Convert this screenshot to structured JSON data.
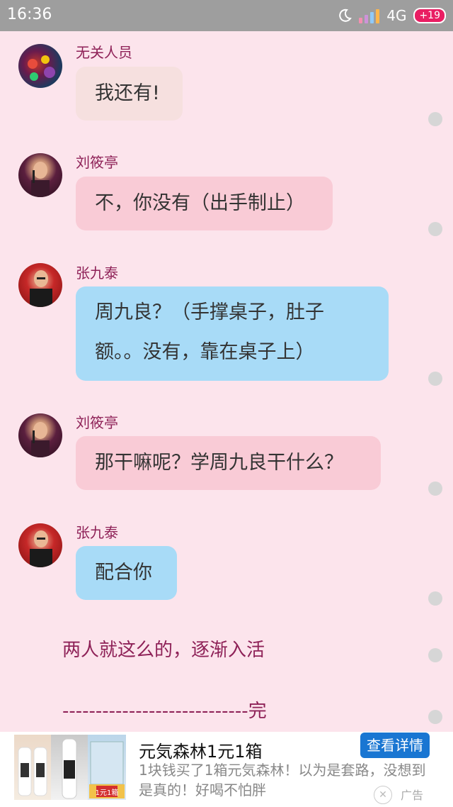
{
  "status_bar": {
    "time": "16:36",
    "network": "4G",
    "battery": "+19",
    "icons": [
      "moon-icon",
      "signal-icon",
      "battery-icon"
    ]
  },
  "messages": [
    {
      "name": "无关人员",
      "text": "我还有!",
      "avatar": "avatar-bystander"
    },
    {
      "name": "刘筱亭",
      "text": "不，你没有（出手制止）",
      "avatar": "avatar-liu"
    },
    {
      "name": "张九泰",
      "lines": [
        "周九良？（手撑桌子，肚子",
        "额。。没有，靠在桌子上）"
      ],
      "avatar": "avatar-zhang"
    },
    {
      "name": "刘筱亭",
      "text": "那干嘛呢？学周九良干什么？",
      "avatar": "avatar-liu"
    },
    {
      "name": "张九泰",
      "text": "配合你",
      "avatar": "avatar-zhang"
    }
  ],
  "narration": "两人就这么的，逐渐入活",
  "ending": "----------------------------完",
  "ad": {
    "title": "元気森林1元1箱",
    "description": "1块钱买了1箱元気森林！以为是套路，没想到是真的！好喝不怕胖",
    "button": "查看详情",
    "close": "✕",
    "label": "广告",
    "badge": "1元1箱"
  },
  "colors": {
    "background": "#fce4ec",
    "name": "#8e2157",
    "bubble_beige": "#f6e0df",
    "bubble_pink": "#f9cbd6",
    "bubble_blue": "#a8dbf7",
    "ad_button": "#1976d2"
  }
}
